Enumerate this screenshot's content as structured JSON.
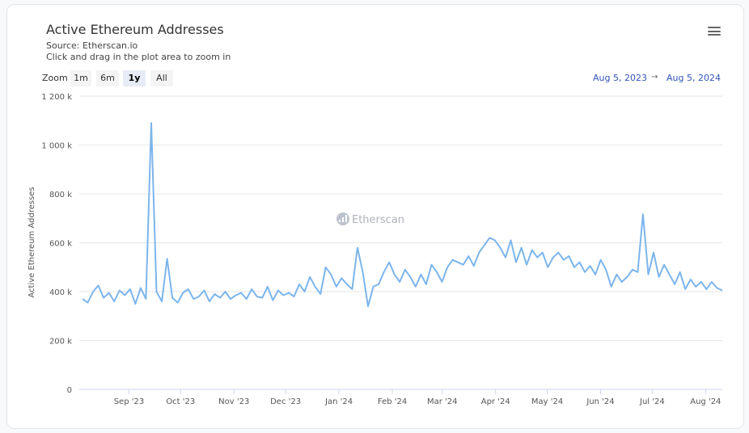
{
  "header": {
    "title": "Active Ethereum Addresses",
    "source": "Source: Etherscan.io",
    "hint": "Click and drag in the plot area to zoom in",
    "menu_icon": "hamburger-menu-icon"
  },
  "zoom": {
    "label": "Zoom",
    "buttons": [
      "1m",
      "6m",
      "1y",
      "All"
    ],
    "selected": "1y"
  },
  "range": {
    "from": "Aug 5, 2023",
    "arrow": "→",
    "to": "Aug 5, 2024"
  },
  "watermark": "Etherscan",
  "chart_data": {
    "type": "line",
    "title": "Active Ethereum Addresses",
    "ylabel": "Active Ethereum Addresses",
    "xlabel": "",
    "ylim": [
      0,
      1200000
    ],
    "y_ticks": [
      "0",
      "200 k",
      "400 k",
      "600 k",
      "800 k",
      "1 000 k",
      "1 200 k"
    ],
    "y_tick_values": [
      0,
      200,
      400,
      600,
      800,
      1000,
      1200
    ],
    "x_ticks": [
      "Sep '23",
      "Oct '23",
      "Nov '23",
      "Dec '23",
      "Jan '24",
      "Feb '24",
      "Mar '24",
      "Apr '24",
      "May '24",
      "Jun '24",
      "Jul '24",
      "Aug '24"
    ],
    "x_range": [
      "2023-08-05",
      "2024-08-05"
    ],
    "sampling": "approx every 3 days",
    "units": "thousands",
    "color": "#7cb5ec",
    "grid": true,
    "values": [
      370,
      355,
      400,
      425,
      375,
      395,
      360,
      405,
      385,
      410,
      350,
      415,
      370,
      1090,
      400,
      360,
      535,
      375,
      355,
      395,
      410,
      370,
      380,
      405,
      360,
      390,
      375,
      400,
      370,
      385,
      395,
      370,
      410,
      380,
      375,
      420,
      365,
      405,
      385,
      395,
      380,
      430,
      400,
      460,
      420,
      390,
      500,
      470,
      420,
      455,
      430,
      410,
      580,
      480,
      340,
      420,
      430,
      480,
      520,
      470,
      440,
      490,
      460,
      420,
      470,
      430,
      510,
      480,
      440,
      500,
      530,
      520,
      510,
      545,
      505,
      560,
      590,
      620,
      610,
      580,
      540,
      610,
      520,
      580,
      510,
      570,
      540,
      560,
      500,
      540,
      560,
      530,
      545,
      500,
      520,
      480,
      505,
      470,
      530,
      490,
      420,
      470,
      440,
      460,
      490,
      480,
      717,
      470,
      560,
      460,
      510,
      470,
      430,
      480,
      410,
      450,
      420,
      440,
      410,
      440,
      415,
      405
    ]
  }
}
